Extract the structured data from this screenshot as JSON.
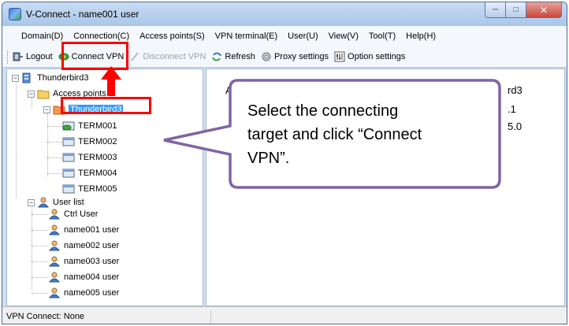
{
  "window": {
    "title": "V-Connect - name001 user"
  },
  "menu": [
    "Domain(D)",
    "Connection(C)",
    "Access points(S)",
    "VPN terminal(E)",
    "User(U)",
    "View(V)",
    "Tool(T)",
    "Help(H)"
  ],
  "toolbar": {
    "logout": "Logout",
    "connect_vpn": "Connect VPN",
    "disconnect_vpn": "Disconnect VPN",
    "refresh": "Refresh",
    "proxy_settings": "Proxy settings",
    "option_settings": "Option settings"
  },
  "tree": {
    "root": "Thunderbird3",
    "access_points": "Access points",
    "selected_ap": "Thunderbird3",
    "terminals": [
      "TERM001",
      "TERM002",
      "TERM003",
      "TERM004",
      "TERM005"
    ],
    "user_list": "User list",
    "users": [
      "Ctrl User",
      "name001 user",
      "name002 user",
      "name003 user",
      "name004 user",
      "name005 user"
    ]
  },
  "detail": {
    "line1_left": "A",
    "line1_right": "rd3",
    "line2_right": ".1",
    "line3_right": "5.0"
  },
  "status": {
    "text": "VPN Connect: None"
  },
  "callout": {
    "line1": "Select the connecting",
    "line2": "target and click “Connect",
    "line3": "VPN”."
  },
  "colors": {
    "highlight": "#ff0000",
    "callout_border": "#8064a2",
    "selection": "#3399ff"
  }
}
